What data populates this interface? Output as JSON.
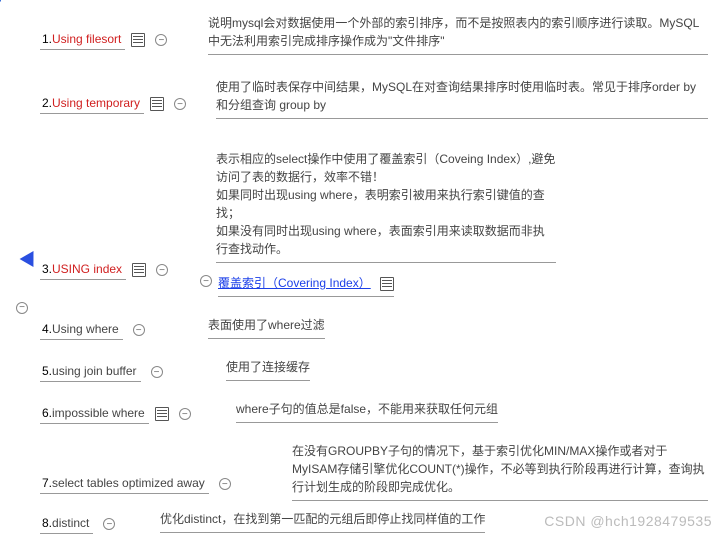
{
  "branches": [
    {
      "num": "1.",
      "label": "Using filesort",
      "highlight": "red",
      "desc": "说明mysql会对数据使用一个外部的索引排序，而不是按照表内的索引顺序进行读取。MySQL中无法利用索引完成排序操作成为\"文件排序\""
    },
    {
      "num": "2.",
      "label": "Using temporary",
      "highlight": "red",
      "desc": "使用了临时表保存中间结果，MySQL在对查询结果排序时使用临时表。常见于排序order by 和分组查询 group by"
    },
    {
      "num": "3.",
      "label": "USING index",
      "highlight": "red",
      "desc": "表示相应的select操作中使用了覆盖索引（Coveing Index）,避免访问了表的数据行，效率不错！\n如果同时出现using where，表明索引被用来执行索引键值的查找；\n如果没有同时出现using where，表面索引用来读取数据而非执行查找动作。",
      "sub": "覆盖索引（Covering Index）"
    },
    {
      "num": "4.",
      "label": "Using where",
      "highlight": "none",
      "desc": "表面使用了where过滤"
    },
    {
      "num": "5.",
      "label": "using join buffer",
      "highlight": "none",
      "desc": "使用了连接缓存"
    },
    {
      "num": "6.",
      "label": "impossible where",
      "highlight": "none",
      "desc": "where子句的值总是false，不能用来获取任何元组"
    },
    {
      "num": "7.",
      "label": "select tables optimized away",
      "highlight": "none",
      "desc": "在没有GROUPBY子句的情况下，基于索引优化MIN/MAX操作或者对于MyISAM存储引擎优化COUNT(*)操作，不必等到执行阶段再进行计算，查询执行计划生成的阶段即完成优化。"
    },
    {
      "num": "8.",
      "label": "distinct",
      "highlight": "none",
      "desc": "优化distinct，在找到第一匹配的元组后即停止找同样值的工作"
    }
  ],
  "watermark": "CSDN @hch1928479535",
  "minus": "−"
}
